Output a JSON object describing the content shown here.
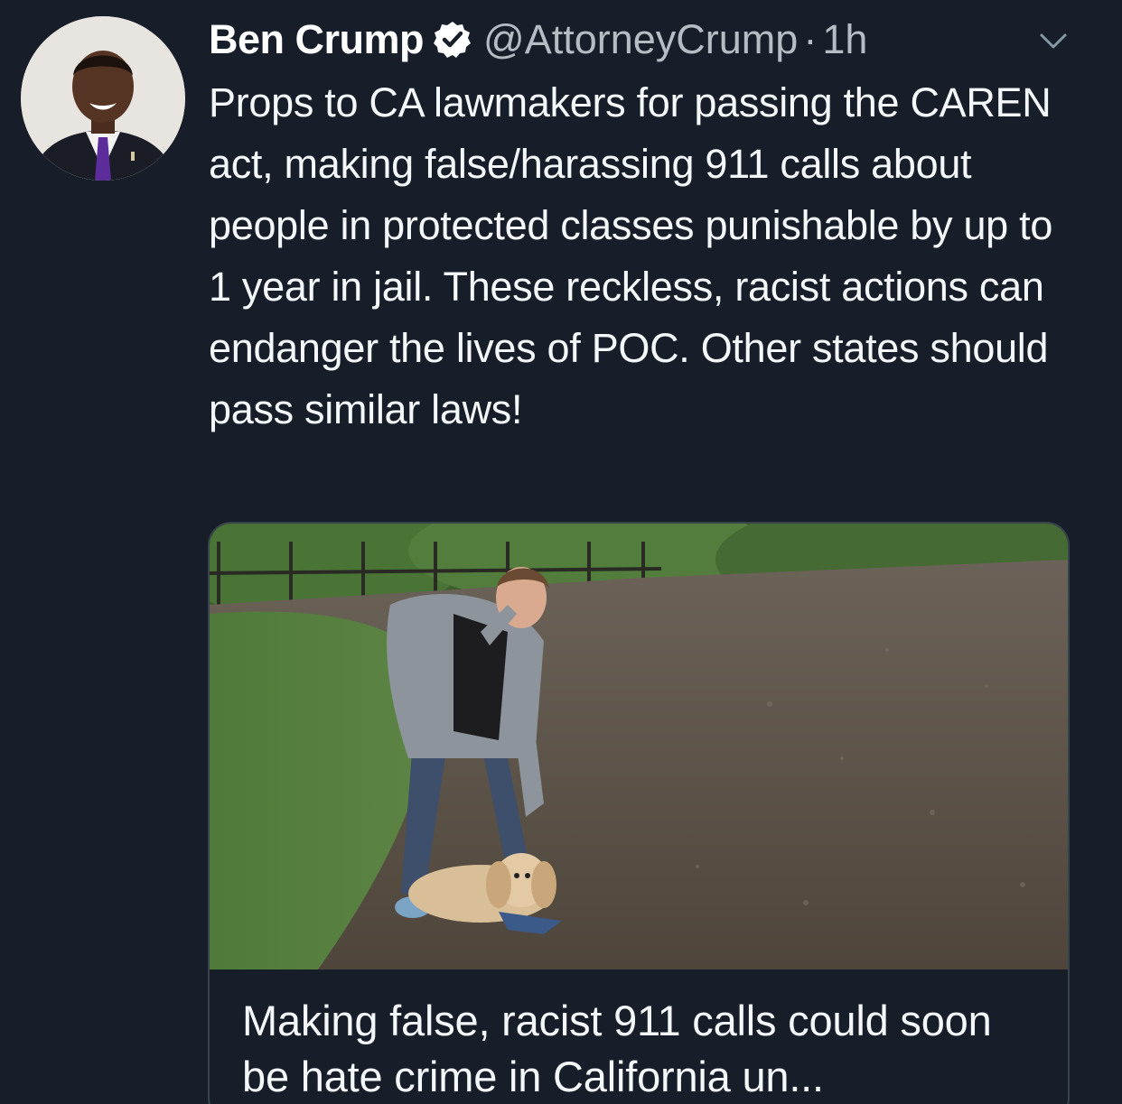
{
  "tweet": {
    "display_name": "Ben Crump",
    "handle": "@AttorneyCrump",
    "separator": "·",
    "time": "1h",
    "text": "Props to CA lawmakers for passing the CAREN act, making false/harassing 911 calls about people in protected classes punishable by up to 1 year in jail. These reckless, racist actions can endanger the lives of POC. Other states should pass similar laws!",
    "verified_icon": "verified-badge-icon",
    "menu_icon": "chevron-down-icon"
  },
  "card": {
    "title": "Making false, racist 911 calls could soon be hate crime in California un..."
  },
  "colors": {
    "background": "#171e29",
    "text": "#f5f8fa",
    "secondary_text": "#b5bcc4",
    "border": "#38444d"
  }
}
